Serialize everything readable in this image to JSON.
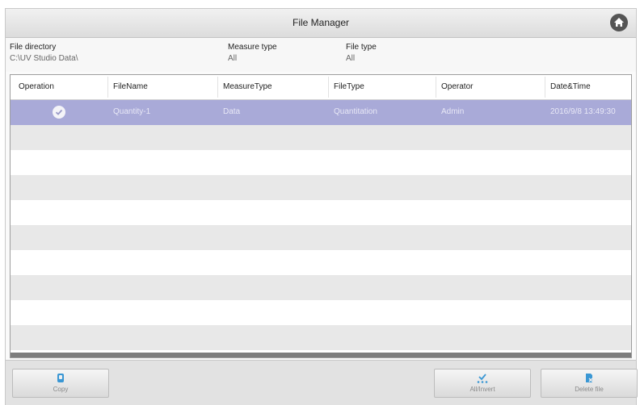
{
  "window": {
    "title": "File Manager"
  },
  "filters": {
    "directory": {
      "label": "File directory",
      "value": "C:\\UV Studio Data\\"
    },
    "measure_type": {
      "label": "Measure type",
      "value": "All"
    },
    "file_type": {
      "label": "File type",
      "value": "All"
    }
  },
  "table": {
    "headers": [
      "Operation",
      "FileName",
      "MeasureType",
      "FileType",
      "Operator",
      "Date&Time"
    ],
    "rows": [
      {
        "selected": true,
        "filename": "Quantity-1",
        "measure_type": "Data",
        "file_type": "Quantitation",
        "operator": "Admin",
        "datetime": "2016/9/8 13:49:30"
      }
    ]
  },
  "toolbar": {
    "copy_label": "Copy",
    "all_invert_label": "All/Invert",
    "delete_label": "Delete file"
  },
  "colors": {
    "selected_row": "#a9aad8",
    "icon_blue": "#3a97d4"
  }
}
